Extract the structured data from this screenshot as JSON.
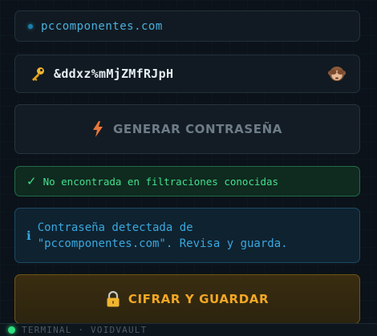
{
  "site_field": {
    "value": "pccomponentes.com",
    "icon": "status-dot"
  },
  "password_field": {
    "value": "&ddxz%mMjZMfRJpH",
    "icon": "key-icon",
    "toggle_icon": "see-no-evil-monkey-icon"
  },
  "generate_button": {
    "label": "GENERAR CONTRASEÑA",
    "icon": "lightning-bolt-icon"
  },
  "leak_status": {
    "check": "✓",
    "label": "No encontrada en filtraciones conocidas",
    "color": "#43e08e"
  },
  "info_notice": {
    "icon_glyph": "ℹ",
    "label": "Contraseña detectada de\n\"pccomponentes.com\". Revisa y guarda."
  },
  "save_button": {
    "label": "CIFRAR Y GUARDAR",
    "icon": "lock-icon",
    "color": "#f2a725"
  },
  "terminal": {
    "label": "TERMINAL · VOIDVAULT"
  }
}
